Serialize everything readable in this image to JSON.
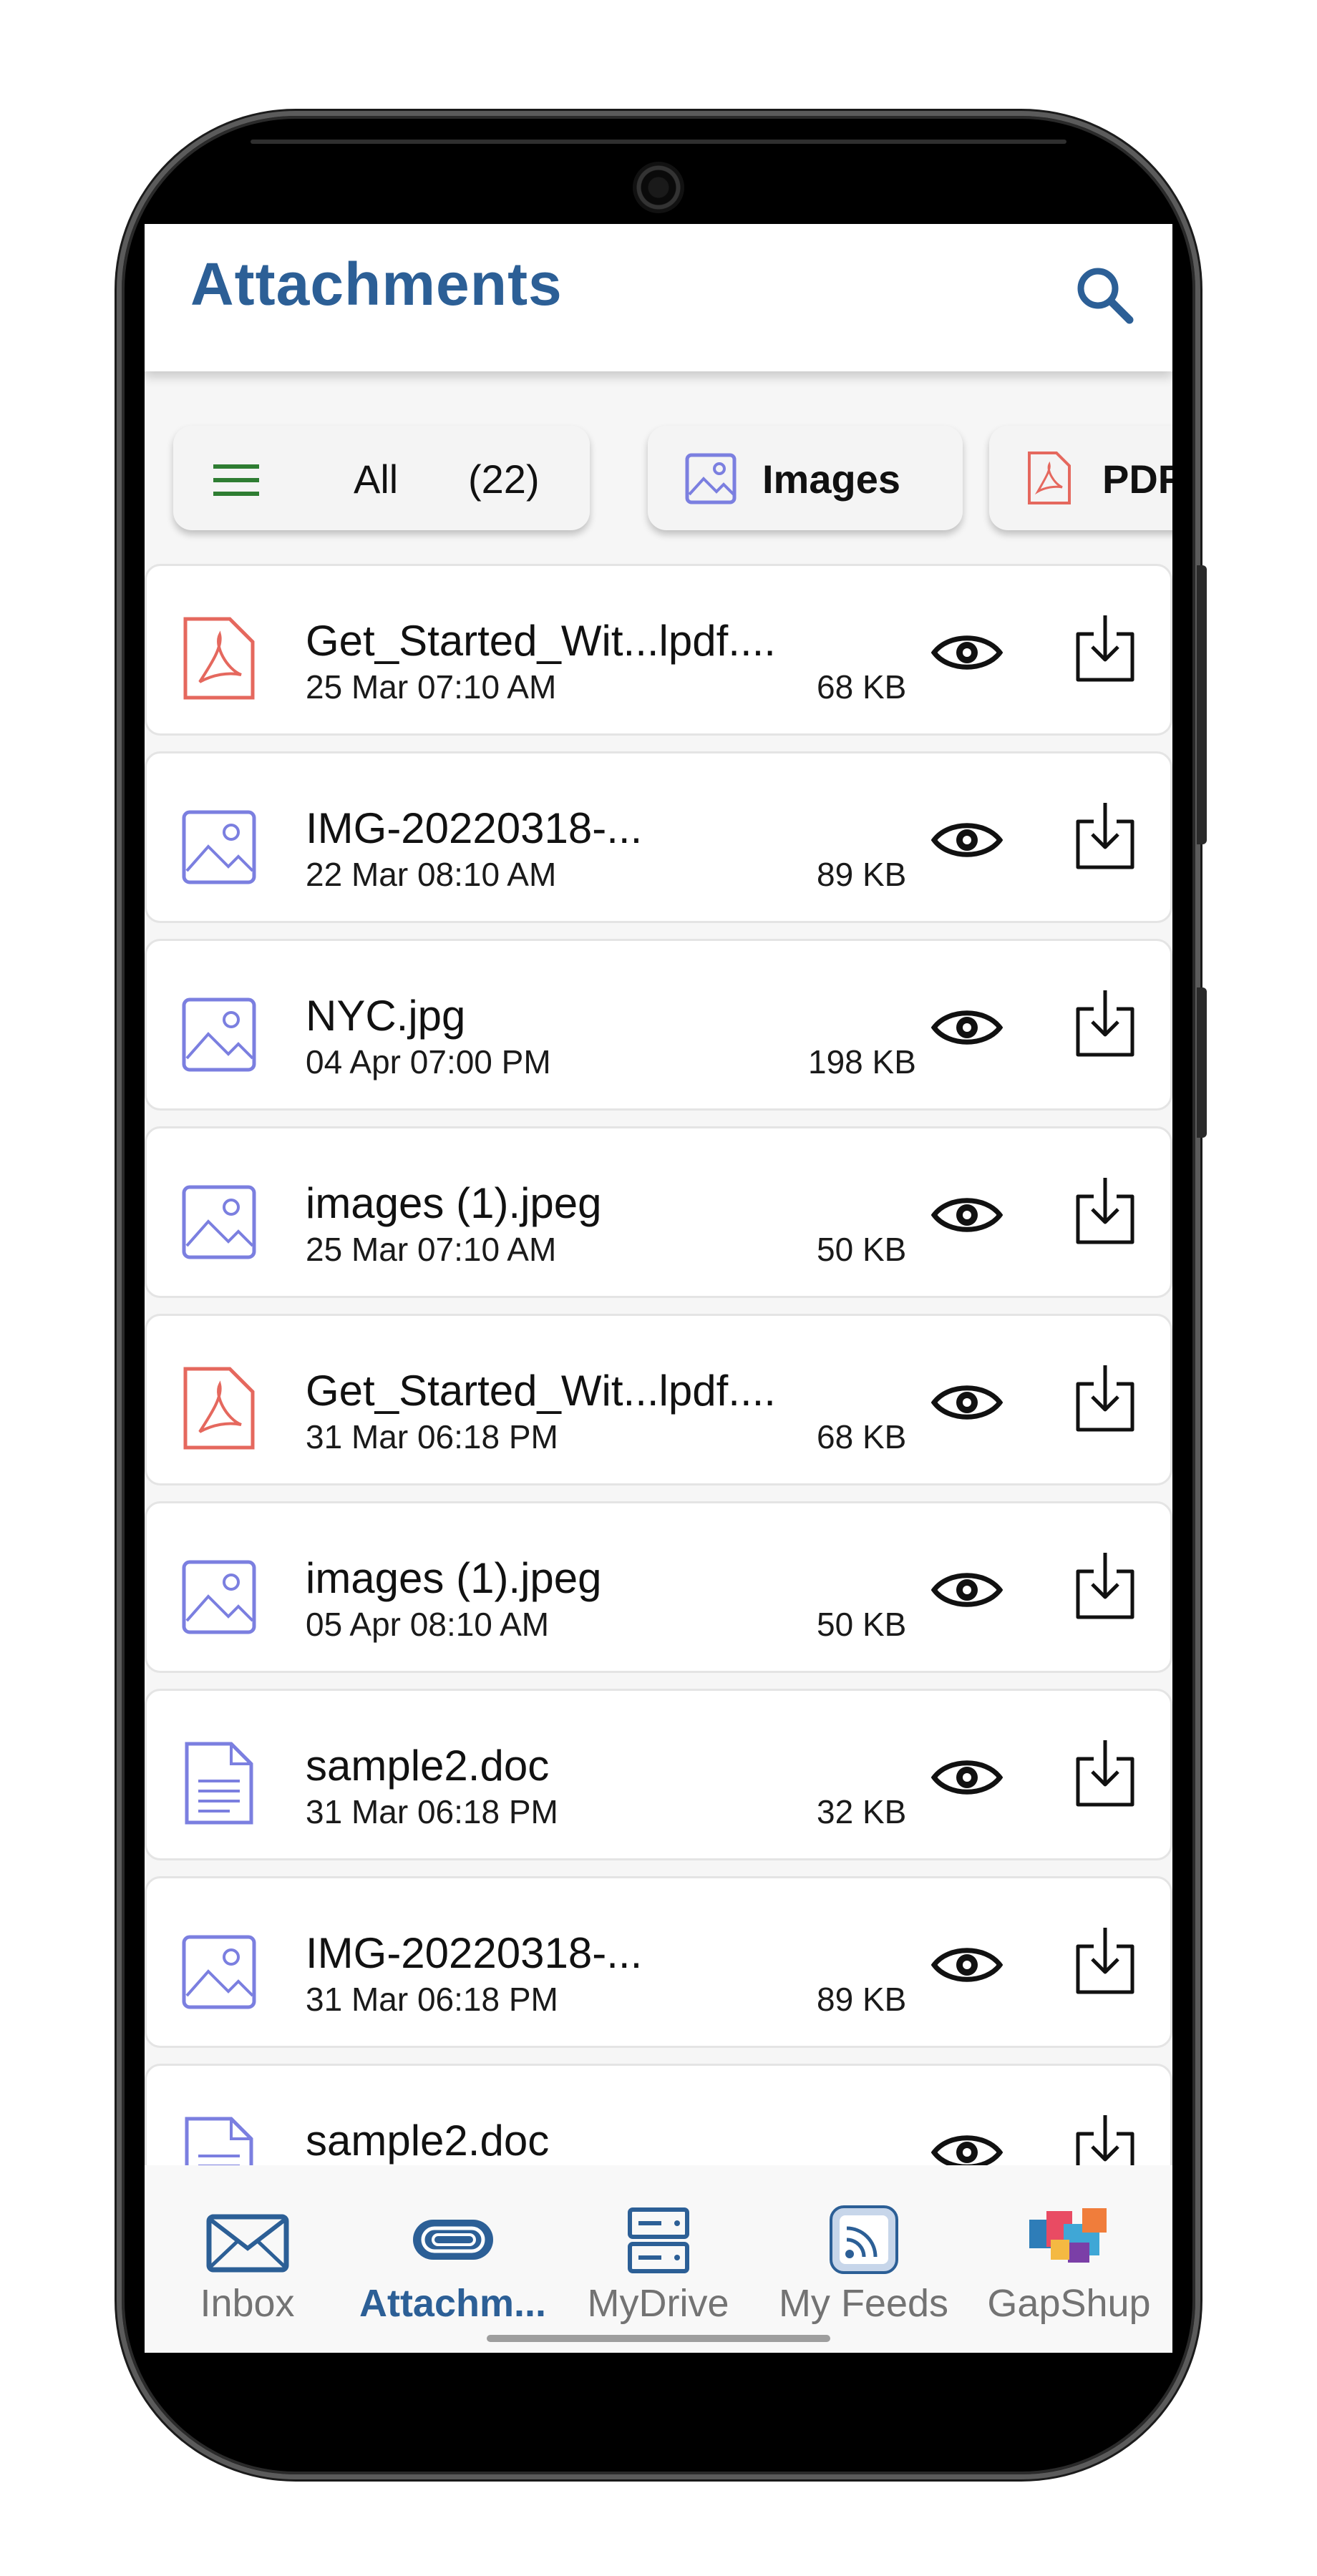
{
  "appbar": {
    "title": "Attachments",
    "search_icon": "search-icon"
  },
  "filters": [
    {
      "label": "All",
      "count": "(22)",
      "icon": "menu-icon",
      "selected": true
    },
    {
      "label": "Images",
      "icon": "image-icon"
    },
    {
      "label": "PDF",
      "icon": "pdf-icon"
    }
  ],
  "files": [
    {
      "name": "Get_Started_Wit...lpdf....",
      "date": "25 Mar 07:10 AM",
      "size": "68  KB",
      "type": "pdf"
    },
    {
      "name": "IMG-20220318-...",
      "date": "22 Mar 08:10 AM",
      "size": "89  KB",
      "type": "image"
    },
    {
      "name": "NYC.jpg",
      "date": "04 Apr 07:00 PM",
      "size": "198  KB",
      "type": "image"
    },
    {
      "name": "images (1).jpeg",
      "date": "25 Mar 07:10 AM",
      "size": "50  KB",
      "type": "image"
    },
    {
      "name": "Get_Started_Wit...lpdf....",
      "date": "31 Mar 06:18 PM",
      "size": "68  KB",
      "type": "pdf"
    },
    {
      "name": "images (1).jpeg",
      "date": "05 Apr 08:10 AM",
      "size": "50  KB",
      "type": "image"
    },
    {
      "name": "sample2.doc",
      "date": "31 Mar 06:18 PM",
      "size": "32  KB",
      "type": "doc"
    },
    {
      "name": "IMG-20220318-...",
      "date": "31 Mar 06:18 PM",
      "size": "89  KB",
      "type": "image"
    },
    {
      "name": "sample2.doc",
      "date": "",
      "size": "",
      "type": "doc"
    }
  ],
  "nav": [
    {
      "label": "Inbox",
      "icon": "envelope-icon"
    },
    {
      "label": "Attachm...",
      "icon": "paperclip-icon",
      "active": true
    },
    {
      "label": "MyDrive",
      "icon": "drive-icon"
    },
    {
      "label": "My Feeds",
      "icon": "rss-feed-icon"
    },
    {
      "label": "GapShup",
      "icon": "gapshup-logo-icon"
    }
  ],
  "colors": {
    "brand": "#2c5f96",
    "pdf": "#e5685e",
    "image": "#7b7fe0",
    "doc": "#7b7fe0"
  }
}
